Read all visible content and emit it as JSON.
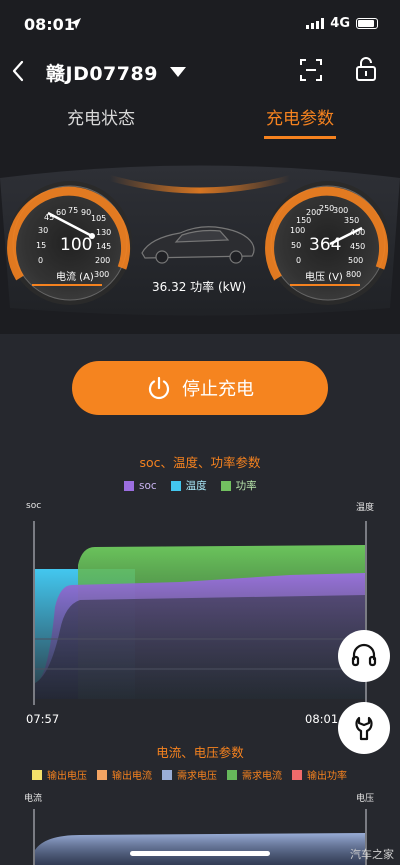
{
  "status_bar": {
    "time": "08:01",
    "network": "4G"
  },
  "header": {
    "plate": "赣JD07789"
  },
  "tabs": [
    {
      "label": "充电状态"
    },
    {
      "label": "充电参数"
    }
  ],
  "dashboard": {
    "current": {
      "value": "100",
      "label": "电流 (A)",
      "ticks": [
        "0",
        "15",
        "30",
        "45",
        "60",
        "75",
        "90",
        "105",
        "130",
        "145",
        "200",
        "300"
      ]
    },
    "voltage": {
      "value": "364",
      "label": "电压 (V)",
      "ticks": [
        "0",
        "50",
        "100",
        "150",
        "200",
        "250",
        "300",
        "350",
        "400",
        "450",
        "500",
        "800"
      ]
    },
    "power": "36.32 功率 (kW)"
  },
  "stop_button": {
    "label": "停止充电"
  },
  "chart1": {
    "title": "soc、温度、功率参数",
    "legend": [
      {
        "name": "soc",
        "color": "#9b6ee0"
      },
      {
        "name": "温度",
        "color": "#43c7ef"
      },
      {
        "name": "功率",
        "color": "#72c160"
      }
    ],
    "left_axis": "soc",
    "right_axis": "温度",
    "start_time": "07:57",
    "end_time": "08:01"
  },
  "chart2": {
    "title": "电流、电压参数",
    "legend": [
      {
        "name": "输出电压",
        "color": "#f3e06a"
      },
      {
        "name": "输出电流",
        "color": "#f3a463"
      },
      {
        "name": "需求电压",
        "color": "#9aaed8"
      },
      {
        "name": "需求电流",
        "color": "#66b85b"
      },
      {
        "name": "输出功率",
        "color": "#ef6b6b"
      }
    ],
    "left_axis": "电流",
    "right_axis": "电压"
  },
  "fabs": [
    {
      "icon": "headset-icon"
    },
    {
      "icon": "wrench-icon"
    }
  ],
  "watermark": "汽车之家",
  "colors": {
    "accent": "#f5821f",
    "background": "#1c1d21",
    "panel": "#26282e"
  }
}
